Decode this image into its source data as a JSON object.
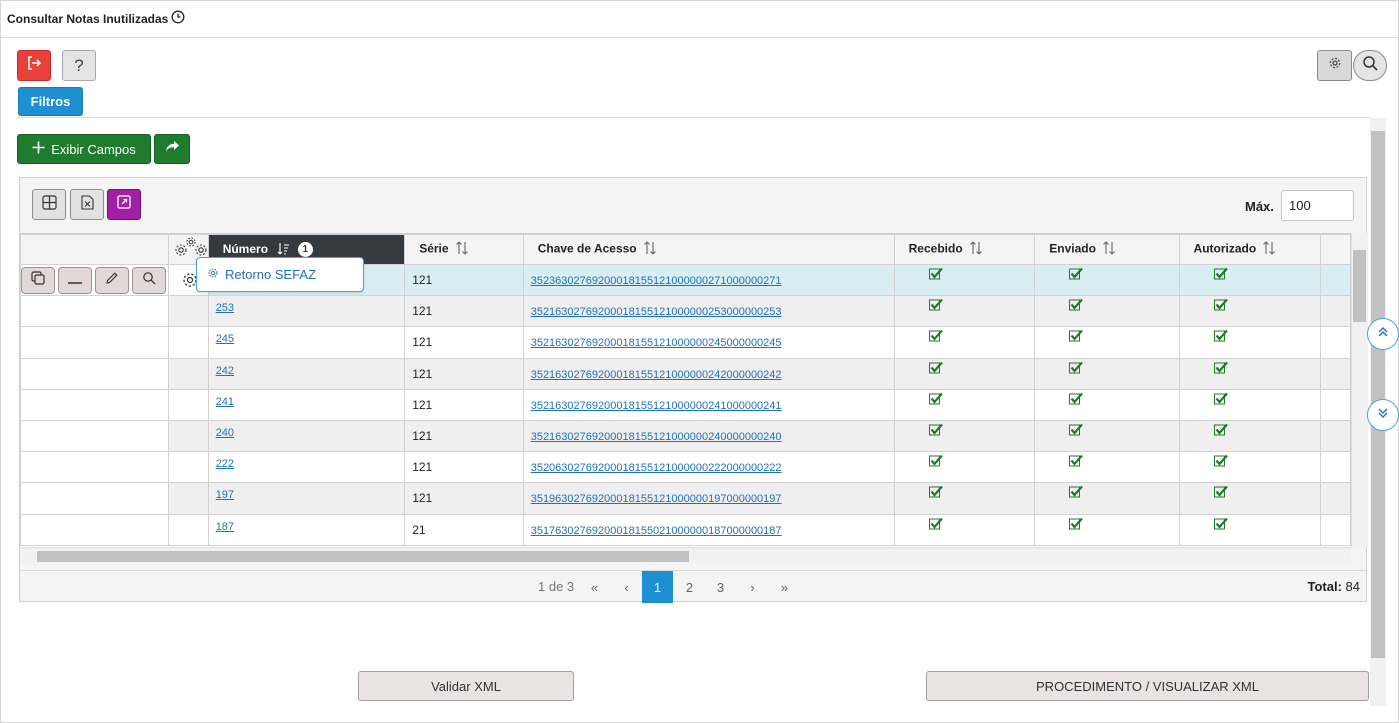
{
  "window": {
    "title": "Consultar Notas Inutilizadas"
  },
  "toolbar": {
    "help_label": "?",
    "filters_label": "Filtros"
  },
  "actions": {
    "show_fields_label": "Exibir Campos"
  },
  "grid_toolbar": {
    "max_label": "Máx.",
    "max_value": "100"
  },
  "table": {
    "columns": [
      "Número",
      "Série",
      "Chave de Acesso",
      "Recebido",
      "Enviado",
      "Autorizado"
    ],
    "sort_badge": "1",
    "rows": [
      {
        "numero": "",
        "serie": "121",
        "chave": "35236302769200018155121000000271000000271",
        "recebido": true,
        "enviado": true,
        "autorizado": true
      },
      {
        "numero": "253",
        "serie": "121",
        "chave": "35216302769200018155121000000253000000253",
        "recebido": true,
        "enviado": true,
        "autorizado": true
      },
      {
        "numero": "245",
        "serie": "121",
        "chave": "35216302769200018155121000000245000000245",
        "recebido": true,
        "enviado": true,
        "autorizado": true
      },
      {
        "numero": "242",
        "serie": "121",
        "chave": "35216302769200018155121000000242000000242",
        "recebido": true,
        "enviado": true,
        "autorizado": true
      },
      {
        "numero": "241",
        "serie": "121",
        "chave": "35216302769200018155121000000241000000241",
        "recebido": true,
        "enviado": true,
        "autorizado": true
      },
      {
        "numero": "240",
        "serie": "121",
        "chave": "35216302769200018155121000000240000000240",
        "recebido": true,
        "enviado": true,
        "autorizado": true
      },
      {
        "numero": "222",
        "serie": "121",
        "chave": "35206302769200018155121000000222000000222",
        "recebido": true,
        "enviado": true,
        "autorizado": true
      },
      {
        "numero": "197",
        "serie": "121",
        "chave": "35196302769200018155121000000197000000197",
        "recebido": true,
        "enviado": true,
        "autorizado": true
      },
      {
        "numero": "187",
        "serie": "21",
        "chave": "35176302769200018155021000000187000000187",
        "recebido": true,
        "enviado": true,
        "autorizado": true
      }
    ]
  },
  "popup": {
    "label": "Retorno SEFAZ"
  },
  "pagination": {
    "info": "1 de 3",
    "first": "«",
    "prev": "‹",
    "pages": [
      "1",
      "2",
      "3"
    ],
    "next": "›",
    "last": "»",
    "total_label": "Total:",
    "total_value": "84"
  },
  "footer": {
    "validate_label": "Validar XML",
    "procedure_label": "PROCEDIMENTO / VISUALIZAR XML"
  },
  "colors": {
    "exit": "#e8413b",
    "filters": "#1e8fd0",
    "green": "#1f7c2f",
    "purple": "#a21fa5",
    "header_dark": "#343a40",
    "link": "#2171b9",
    "selected_row": "#d9eef2"
  },
  "icons": [
    "clock-icon",
    "exit-icon",
    "help-icon",
    "gear-icon",
    "search-icon",
    "plus-icon",
    "share-icon",
    "table-icon",
    "excel-icon",
    "expand-icon",
    "copy-icon",
    "minus-icon",
    "pencil-icon",
    "magnifier-icon",
    "check-icon",
    "chevrons-up-icon",
    "chevrons-down-icon"
  ]
}
